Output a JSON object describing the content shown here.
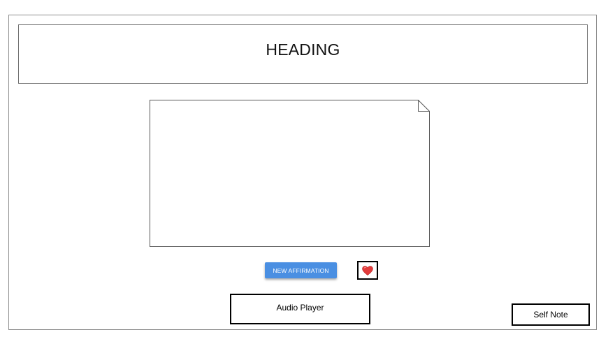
{
  "header": {
    "title": "HEADING"
  },
  "controls": {
    "new_affirmation_label": "NEW AFFIRMATION",
    "favorite_icon": "heart-icon",
    "audio_player_label": "Audio Player",
    "self_note_label": "Self Note"
  },
  "colors": {
    "button_blue": "#4a8fe2",
    "heart_red": "#e23b3b"
  }
}
